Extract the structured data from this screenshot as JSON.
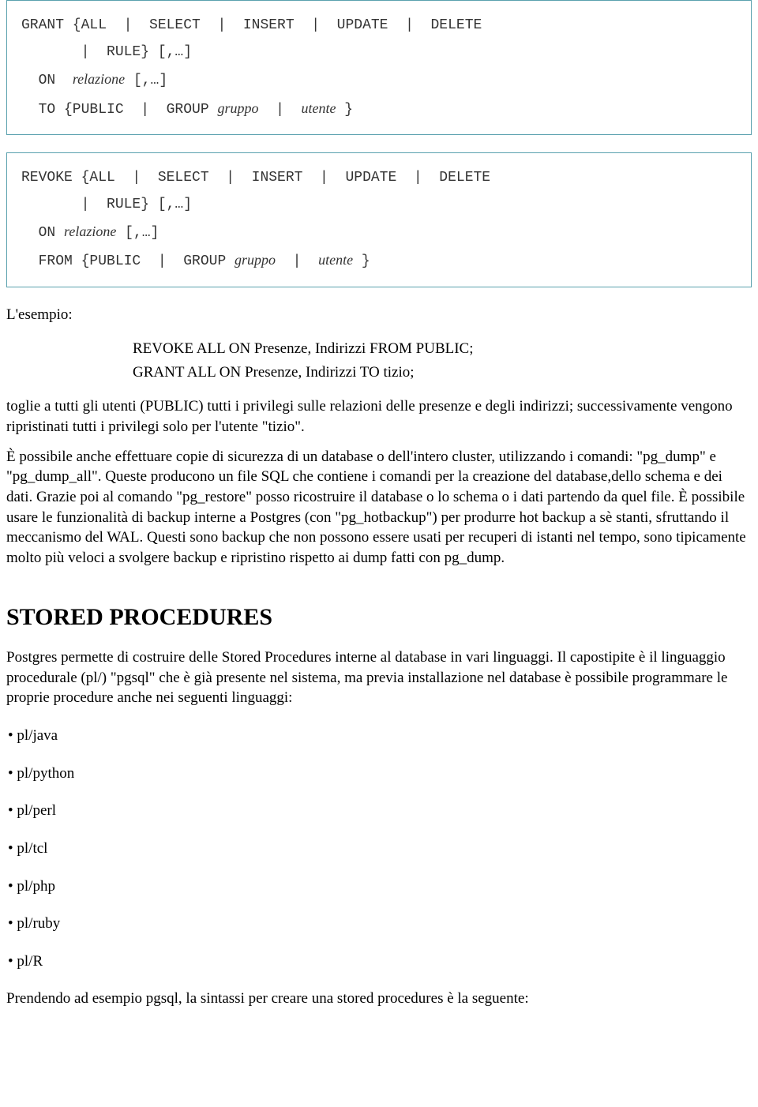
{
  "grant": {
    "l1": "GRANT {ALL  |  SELECT  |  INSERT  |  UPDATE  |  DELETE",
    "l2": "       |  RULE} [,…]",
    "l3a": "  ON  ",
    "l3b": "relazione",
    "l3c": " [,…]",
    "l4a": "  TO {PUBLIC  |  GROUP ",
    "l4b": "gruppo",
    "l4c": "  |  ",
    "l4d": "utente",
    "l4e": " }"
  },
  "revoke": {
    "l1": "REVOKE {ALL  |  SELECT  |  INSERT  |  UPDATE  |  DELETE",
    "l2": "       |  RULE} [,…]",
    "l3a": "  ON ",
    "l3b": "relazione",
    "l3c": " [,…]",
    "l4a": "  FROM {PUBLIC  |  GROUP ",
    "l4b": "gruppo",
    "l4c": "  |  ",
    "l4d": "utente",
    "l4e": " }"
  },
  "intro": "L'esempio:",
  "ex1": "REVOKE ALL ON Presenze, Indirizzi FROM PUBLIC;",
  "ex2": "GRANT ALL ON Presenze, Indirizzi TO tizio;",
  "para1": "toglie a tutti gli utenti (PUBLIC) tutti i privilegi sulle relazioni delle presenze e degli indirizzi; successivamente vengono ripristinati tutti i privilegi solo per l'utente \"tizio\".",
  "para2": "È possibile anche effettuare copie di sicurezza di un database o dell'intero cluster, utilizzando i comandi: \"pg_dump\" e \"pg_dump_all\". Queste producono un file SQL che contiene i comandi per la creazione del database,dello schema e dei dati. Grazie poi al comando \"pg_restore\" posso ricostruire il database o lo schema o i dati partendo da quel file. È possibile usare le funzionalità di backup interne a Postgres (con \"pg_hotbackup\") per produrre hot backup a sè stanti, sfruttando il meccanismo del WAL. Questi sono backup che non possono essere usati per recuperi di istanti nel tempo, sono tipicamente molto più veloci a svolgere backup e ripristino rispetto ai dump fatti con pg_dump.",
  "heading": "STORED PROCEDURES",
  "para3": "Postgres permette di costruire delle Stored Procedures interne al database in vari linguaggi. Il capostipite è il linguaggio procedurale (pl/) \"pgsql\" che è già presente nel sistema, ma previa installazione nel database è possibile programmare le proprie procedure anche nei seguenti linguaggi:",
  "langs": [
    "pl/java",
    "pl/python",
    "pl/perl",
    "pl/tcl",
    "pl/php",
    "pl/ruby",
    "pl/R"
  ],
  "para4": "Prendendo ad esempio pgsql, la sintassi per creare una stored procedures è la seguente:"
}
